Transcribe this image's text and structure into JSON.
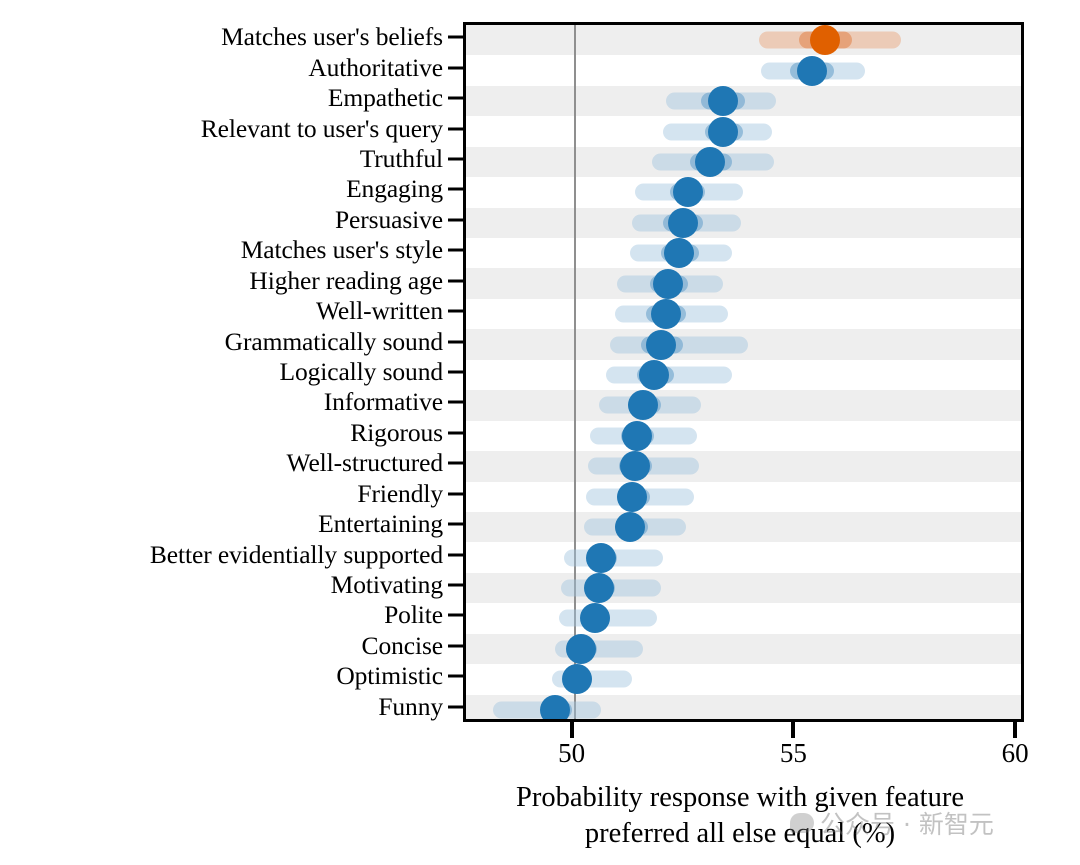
{
  "chart_data": {
    "type": "scatter",
    "title": "",
    "xlabel": "Probability response with given feature preferred all else equal (%)",
    "ylabel": "",
    "xlim": [
      47.55,
      60.2
    ],
    "xticks": [
      50,
      55,
      60
    ],
    "xticklabels": [
      "50",
      "55",
      "60"
    ],
    "reference_line_x": 50,
    "grid": false,
    "legend": null,
    "alternating_row_shading": true,
    "colors": {
      "highlight_point": "#e06000",
      "highlight_inner_ci": "#e28750",
      "highlight_outer_ci": "#e8a073",
      "point": "#1f77b4",
      "inner_ci": "#6ea5cd",
      "outer_ci": "#a0c3de",
      "reference_line": "#8f8f8f",
      "row_stripe": "#eeeeee",
      "axis": "#000000"
    },
    "categories": [
      "Matches user's beliefs",
      "Authoritative",
      "Empathetic",
      "Relevant to user's query",
      "Truthful",
      "Engaging",
      "Persuasive",
      "Matches user's style",
      "Higher reading age",
      "Well-written",
      "Grammatically sound",
      "Logically sound",
      "Informative",
      "Rigorous",
      "Well-structured",
      "Friendly",
      "Entertaining",
      "Better evidentially supported",
      "Motivating",
      "Polite",
      "Concise",
      "Optimistic",
      "Funny"
    ],
    "points": [
      {
        "label": "Matches user's beliefs",
        "value": 55.65,
        "inner_ci": [
          55.05,
          56.25
        ],
        "outer_ci": [
          54.15,
          57.35
        ],
        "highlight": true
      },
      {
        "label": "Authoritative",
        "value": 55.35,
        "inner_ci": [
          54.85,
          55.85
        ],
        "outer_ci": [
          54.2,
          56.55
        ],
        "highlight": false
      },
      {
        "label": "Empathetic",
        "value": 53.35,
        "inner_ci": [
          52.85,
          53.85
        ],
        "outer_ci": [
          52.05,
          54.55
        ],
        "highlight": false
      },
      {
        "label": "Relevant to user's query",
        "value": 53.35,
        "inner_ci": [
          52.95,
          53.8
        ],
        "outer_ci": [
          52.0,
          54.45
        ],
        "highlight": false
      },
      {
        "label": "Truthful",
        "value": 53.05,
        "inner_ci": [
          52.6,
          53.55
        ],
        "outer_ci": [
          51.75,
          54.5
        ],
        "highlight": false
      },
      {
        "label": "Engaging",
        "value": 52.55,
        "inner_ci": [
          52.15,
          52.95
        ],
        "outer_ci": [
          51.35,
          53.8
        ],
        "highlight": false
      },
      {
        "label": "Persuasive",
        "value": 52.45,
        "inner_ci": [
          52.0,
          52.9
        ],
        "outer_ci": [
          51.3,
          53.75
        ],
        "highlight": false
      },
      {
        "label": "Matches user's style",
        "value": 52.35,
        "inner_ci": [
          51.95,
          52.8
        ],
        "outer_ci": [
          51.25,
          53.55
        ],
        "highlight": false
      },
      {
        "label": "Higher reading age",
        "value": 52.1,
        "inner_ci": [
          51.7,
          52.55
        ],
        "outer_ci": [
          50.95,
          53.35
        ],
        "highlight": false
      },
      {
        "label": "Well-written",
        "value": 52.05,
        "inner_ci": [
          51.6,
          52.5
        ],
        "outer_ci": [
          50.9,
          53.45
        ],
        "highlight": false
      },
      {
        "label": "Grammatically sound",
        "value": 51.95,
        "inner_ci": [
          51.5,
          52.45
        ],
        "outer_ci": [
          50.8,
          53.9
        ],
        "highlight": false
      },
      {
        "label": "Logically sound",
        "value": 51.8,
        "inner_ci": [
          51.4,
          52.25
        ],
        "outer_ci": [
          50.7,
          53.55
        ],
        "highlight": false
      },
      {
        "label": "Informative",
        "value": 51.55,
        "inner_ci": [
          51.2,
          51.95
        ],
        "outer_ci": [
          50.55,
          52.85
        ],
        "highlight": false
      },
      {
        "label": "Rigorous",
        "value": 51.4,
        "inner_ci": [
          51.05,
          51.8
        ],
        "outer_ci": [
          50.35,
          52.75
        ],
        "highlight": false
      },
      {
        "label": "Well-structured",
        "value": 51.35,
        "inner_ci": [
          51.0,
          51.75
        ],
        "outer_ci": [
          50.3,
          52.8
        ],
        "highlight": false
      },
      {
        "label": "Friendly",
        "value": 51.3,
        "inner_ci": [
          50.95,
          51.7
        ],
        "outer_ci": [
          50.25,
          52.7
        ],
        "highlight": false
      },
      {
        "label": "Entertaining",
        "value": 51.25,
        "inner_ci": [
          50.9,
          51.65
        ],
        "outer_ci": [
          50.2,
          52.5
        ],
        "highlight": false
      },
      {
        "label": "Better evidentially supported",
        "value": 50.6,
        "inner_ci": [
          50.3,
          50.95
        ],
        "outer_ci": [
          49.75,
          52.0
        ],
        "highlight": false
      },
      {
        "label": "Motivating",
        "value": 50.55,
        "inner_ci": [
          50.25,
          50.9
        ],
        "outer_ci": [
          49.7,
          51.95
        ],
        "highlight": false
      },
      {
        "label": "Polite",
        "value": 50.45,
        "inner_ci": [
          50.15,
          50.8
        ],
        "outer_ci": [
          49.65,
          51.85
        ],
        "highlight": false
      },
      {
        "label": "Concise",
        "value": 50.15,
        "inner_ci": [
          49.85,
          50.5
        ],
        "outer_ci": [
          49.55,
          51.55
        ],
        "highlight": false
      },
      {
        "label": "Optimistic",
        "value": 50.05,
        "inner_ci": [
          49.8,
          50.4
        ],
        "outer_ci": [
          49.5,
          51.3
        ],
        "highlight": false
      },
      {
        "label": "Funny",
        "value": 49.55,
        "inner_ci": [
          49.25,
          49.95
        ],
        "outer_ci": [
          48.15,
          50.6
        ],
        "highlight": false
      }
    ]
  },
  "watermark": {
    "text": "公众号 · 新智元"
  }
}
